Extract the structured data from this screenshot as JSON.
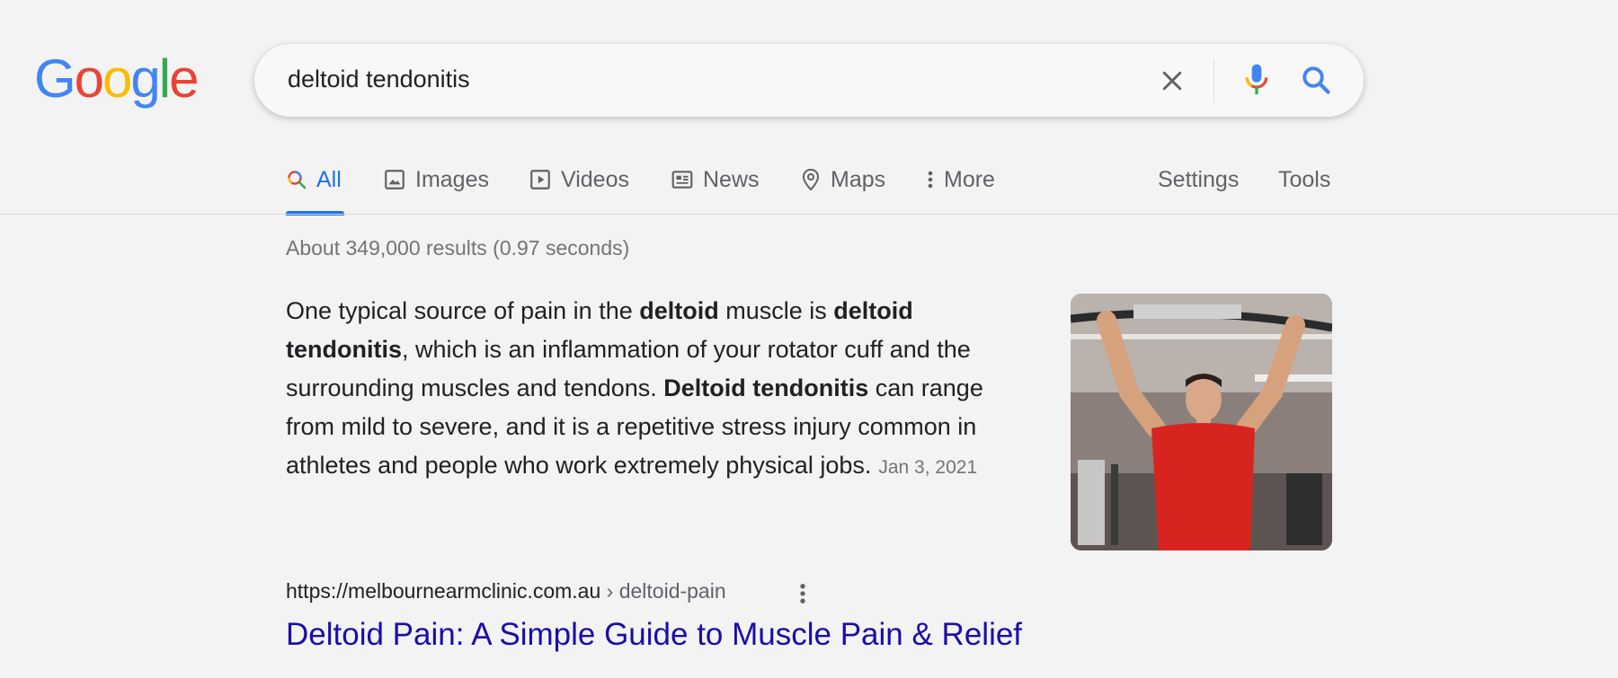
{
  "logo": {
    "letters": [
      "G",
      "o",
      "o",
      "g",
      "l",
      "e"
    ]
  },
  "search": {
    "query": "deltoid tendonitis"
  },
  "tabs": [
    {
      "label": "All"
    },
    {
      "label": "Images"
    },
    {
      "label": "Videos"
    },
    {
      "label": "News"
    },
    {
      "label": "Maps"
    },
    {
      "label": "More"
    }
  ],
  "tools": {
    "settings": "Settings",
    "tools": "Tools"
  },
  "stats": "About 349,000 results (0.97 seconds)",
  "snippet": {
    "p1": "One typical source of pain in the ",
    "b1": "deltoid",
    "p2": " muscle is ",
    "b2": "deltoid tendonitis",
    "p3": ", which is an inflammation of your rotator cuff and the surrounding muscles and tendons. ",
    "b3": "Deltoid tendonitis",
    "p4": " can range from mild to severe, and it is a repetitive stress injury common in athletes and people who work extremely physical jobs.",
    "date": "Jan 3, 2021"
  },
  "result": {
    "url": "https://melbournearmclinic.com.au",
    "breadcrumb": " › deltoid-pain",
    "title": "Deltoid Pain: A Simple Guide to Muscle Pain & Relief"
  },
  "colors": {
    "blue": "#4285F4",
    "red": "#EA4335",
    "yellow": "#FBBC05",
    "green": "#34A853",
    "link": "#1a0dab",
    "accent": "#1a73e8"
  },
  "icons": [
    "search-icon",
    "image-icon",
    "video-icon",
    "news-icon",
    "map-pin-icon",
    "more-vert-icon",
    "clear-icon",
    "mic-icon"
  ]
}
